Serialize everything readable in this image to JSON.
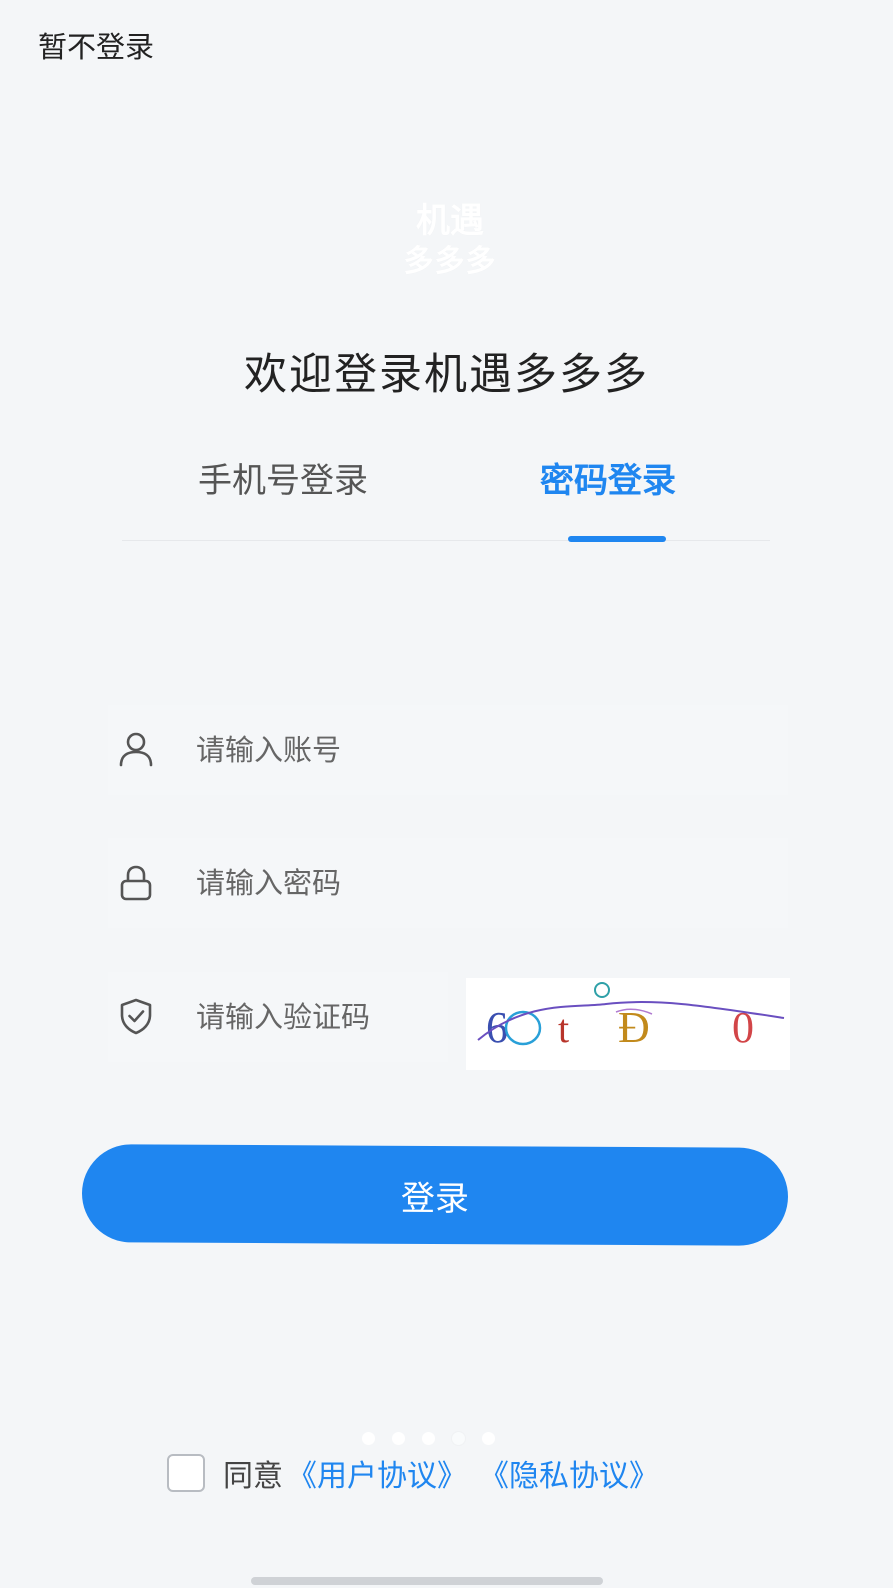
{
  "header": {
    "skip_label": "暂不登录"
  },
  "logo": {
    "line1": "机遇",
    "line2": "多多多"
  },
  "welcome": "欢迎登录机遇多多多",
  "tabs": [
    {
      "label": "手机号登录",
      "active": false
    },
    {
      "label": "密码登录",
      "active": true
    }
  ],
  "form": {
    "account": {
      "placeholder": "请输入账号",
      "icon": "user-icon"
    },
    "password": {
      "placeholder": "请输入密码",
      "icon": "lock-icon"
    },
    "captcha": {
      "placeholder": "请输入验证码",
      "icon": "shield-check-icon",
      "code_text": "6Ot D 0"
    }
  },
  "login_button": "登录",
  "agreement": {
    "prefix": "同意",
    "user_agreement": "《用户协议》",
    "privacy_policy": "《隐私协议》"
  },
  "colors": {
    "accent": "#1f86f0",
    "background": "#f4f6f8"
  }
}
